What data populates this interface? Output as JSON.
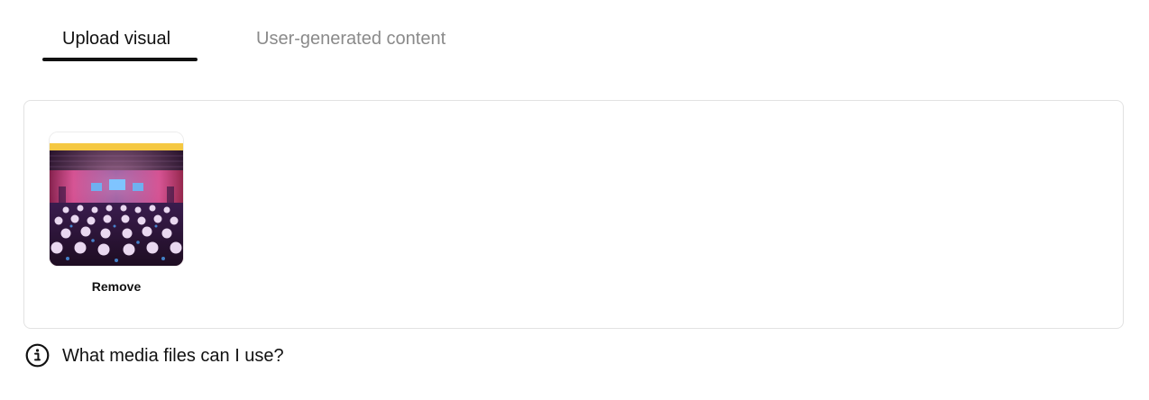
{
  "tabs": {
    "items": [
      {
        "label": "Upload visual",
        "active": true
      },
      {
        "label": "User-generated content",
        "active": false
      }
    ]
  },
  "media": {
    "items": [
      {
        "thumbnail_icon": "event-photo-thumbnail",
        "remove_label": "Remove"
      }
    ]
  },
  "help": {
    "icon": "info-icon",
    "label": "What media files can I use?"
  },
  "colors": {
    "text": "#111111",
    "inactive_tab": "#8a8a8a",
    "border": "#e2e2e2",
    "thumbnail_banner": "#f5c842"
  }
}
